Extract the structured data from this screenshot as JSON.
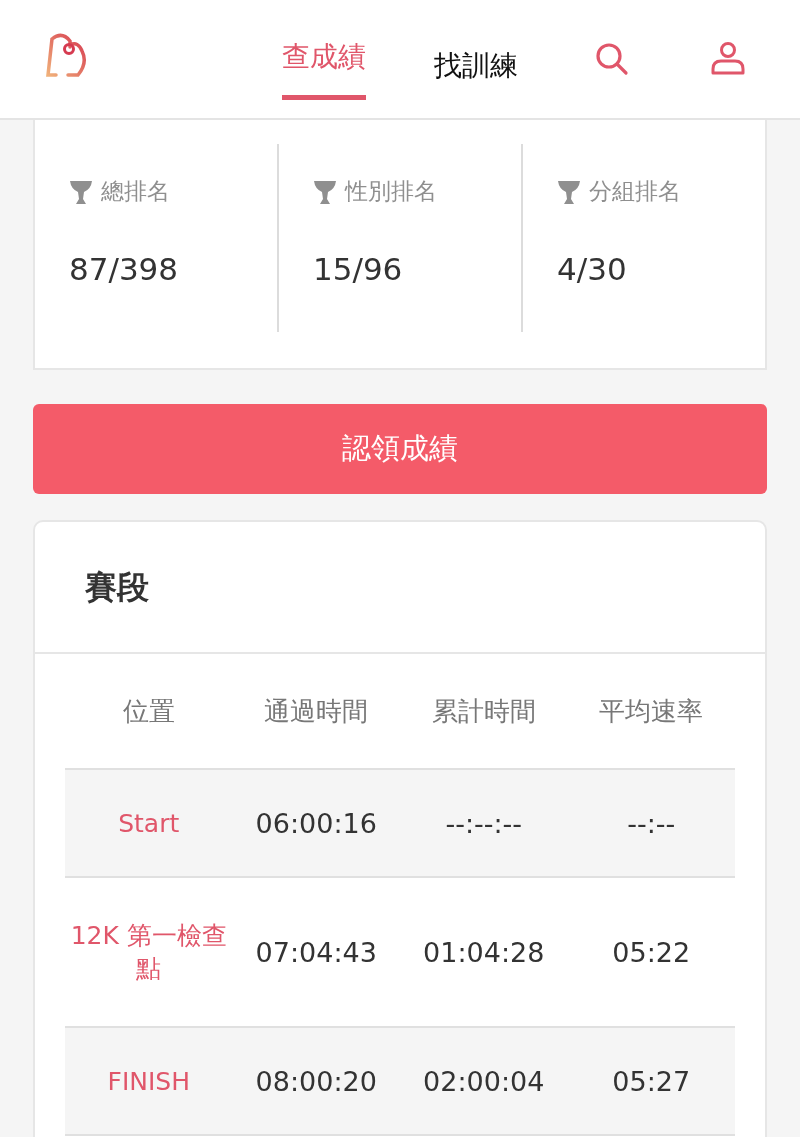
{
  "nav": {
    "tabs": [
      {
        "label": "查成績",
        "selected": true
      },
      {
        "label": "找訓練",
        "selected": false
      }
    ]
  },
  "rankings": [
    {
      "label": "總排名",
      "value": "87/398"
    },
    {
      "label": "性別排名",
      "value": "15/96"
    },
    {
      "label": "分組排名",
      "value": "4/30"
    }
  ],
  "claim_button": "認領成績",
  "segments": {
    "title": "賽段",
    "columns": [
      "位置",
      "通過時間",
      "累計時間",
      "平均速率"
    ],
    "rows": [
      {
        "location": "Start",
        "pass_time": "06:00:16",
        "cumulative": "--:--:--",
        "pace": "--:--"
      },
      {
        "location": "12K 第一檢查點",
        "pass_time": "07:04:43",
        "cumulative": "01:04:28",
        "pace": "05:22"
      },
      {
        "location": "FINISH",
        "pass_time": "08:00:20",
        "cumulative": "02:00:04",
        "pace": "05:27"
      }
    ]
  }
}
